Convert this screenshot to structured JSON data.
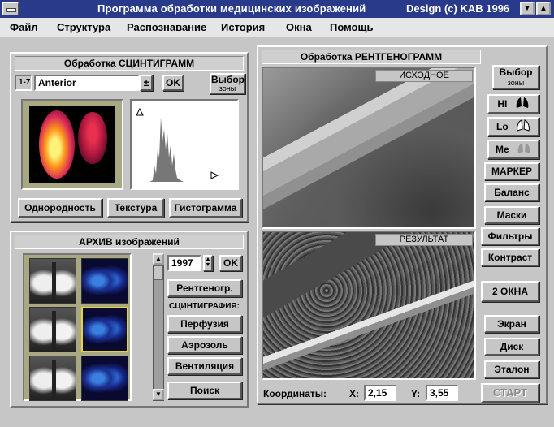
{
  "window": {
    "title": "Программа обработки медицинских изображений",
    "copyright": "Design (c) KAB 1996",
    "min_button": "▼",
    "max_button": "▲"
  },
  "menu": [
    "Файл",
    "Структура",
    "Распознавание",
    "История",
    "Окна",
    "Помощь"
  ],
  "scinti_panel": {
    "title": "Обработка СЦИНТИГРАММ",
    "range_label": "1-7",
    "projection_value": "Anterior",
    "dropdown_arrow": "±",
    "ok": "OK",
    "select_zone_line1": "Выбор",
    "select_zone_line2": "зоны",
    "buttons": [
      "Однородность",
      "Текстура",
      "Гистограмма"
    ]
  },
  "archive_panel": {
    "title": "АРХИВ изображений",
    "year_value": "1997",
    "ok": "OK",
    "xray_button": "Рентгеногр.",
    "scinti_section": "СЦИНТИГРАФИЯ:",
    "buttons": [
      "Перфузия",
      "Аэрозоль",
      "Вентиляция",
      "Поиск"
    ]
  },
  "xray_panel": {
    "title": "Обработка РЕНТГЕНОГРАММ",
    "source_label": "ИСХОДНОЕ",
    "result_label": "РЕЗУЛЬТАТ",
    "coords_label": "Координаты:",
    "x_label": "X:",
    "x_value": "2,15",
    "y_label": "Y:",
    "y_value": "3,55"
  },
  "right_buttons": {
    "select_zone_line1": "Выбор",
    "select_zone_line2": "зоны",
    "hi": "HI",
    "lo": "Lo",
    "me": "Me",
    "marker": "МАРКЕР",
    "balance": "Баланс",
    "masks": "Маски",
    "filters": "Фильтры",
    "contrast": "Контраст",
    "two_windows": "2 ОКНА",
    "screen": "Экран",
    "disk": "Диск",
    "etalon": "Эталон",
    "start": "СТАРТ"
  },
  "colors": {
    "titlebar": "#2a3a8a",
    "face": "#c6c6c6",
    "selection_border": "#e5d04a"
  }
}
